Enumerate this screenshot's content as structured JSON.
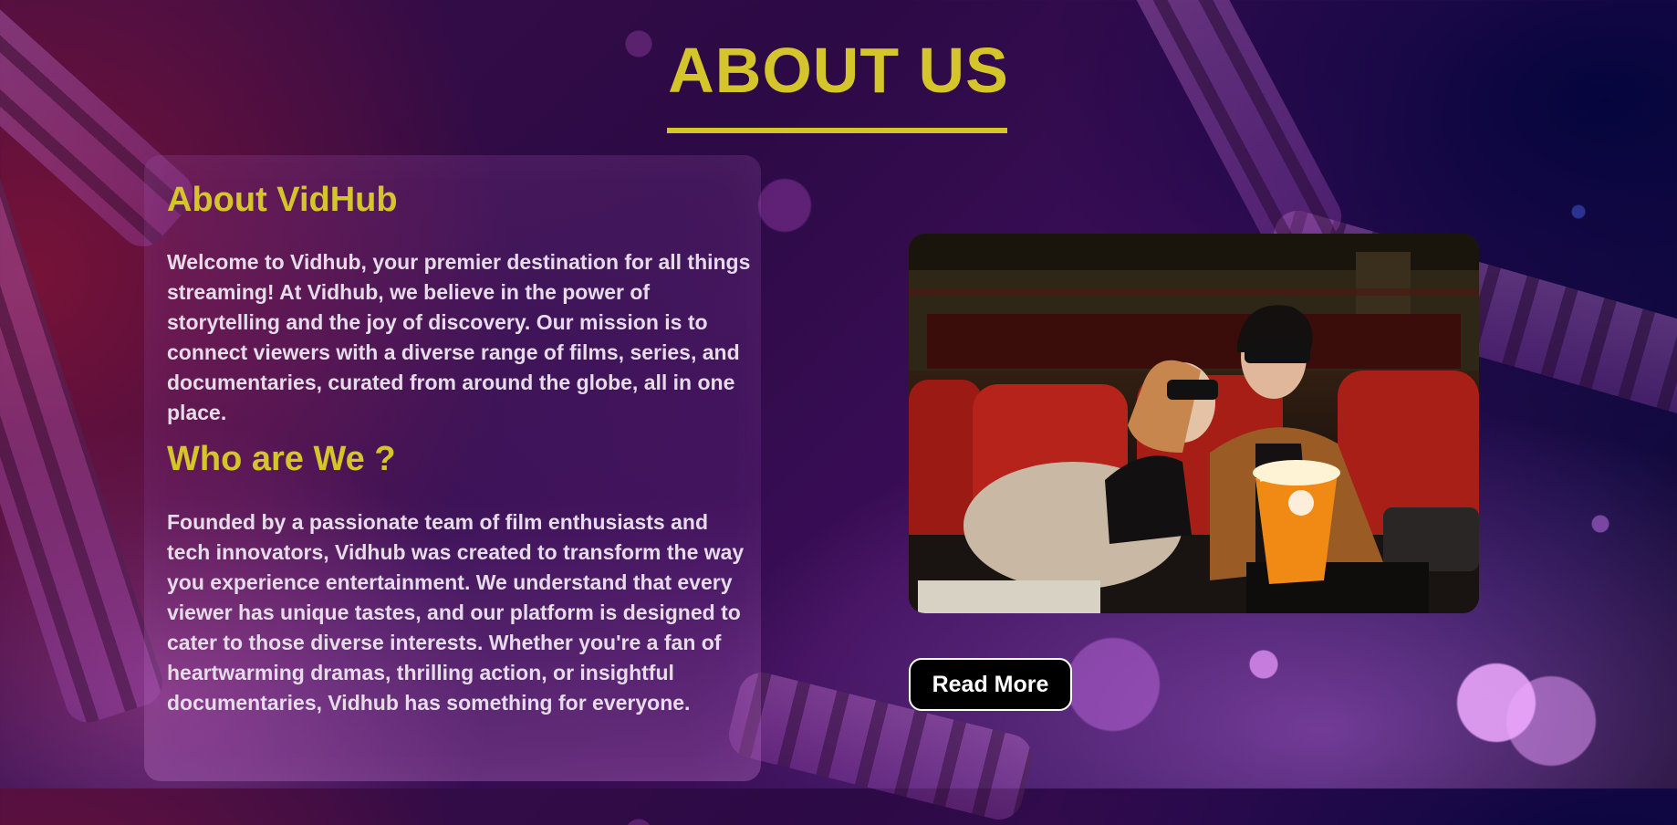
{
  "page": {
    "title": "ABOUT US"
  },
  "about": {
    "heading": "About VidHub",
    "body": "Welcome to Vidhub, your premier destination for all things streaming! At Vidhub, we believe in the power of storytelling and the joy of discovery. Our mission is to connect viewers with a diverse range of films, series, and documentaries, curated from around the globe, all in one place."
  },
  "who": {
    "heading": "Who are We ?",
    "body": "Founded by a passionate team of film enthusiasts and tech innovators, Vidhub was created to transform the way you experience entertainment. We understand that every viewer has unique tastes, and our platform is designed to cater to those diverse interests. Whether you're a fan of heartwarming dramas, thrilling action, or insightful documentaries, Vidhub has something for everyone."
  },
  "actions": {
    "read_more_label": "Read More"
  },
  "theme": {
    "accent": "#d4c52b",
    "text": "#e6dbe8",
    "button_bg": "#000000"
  }
}
